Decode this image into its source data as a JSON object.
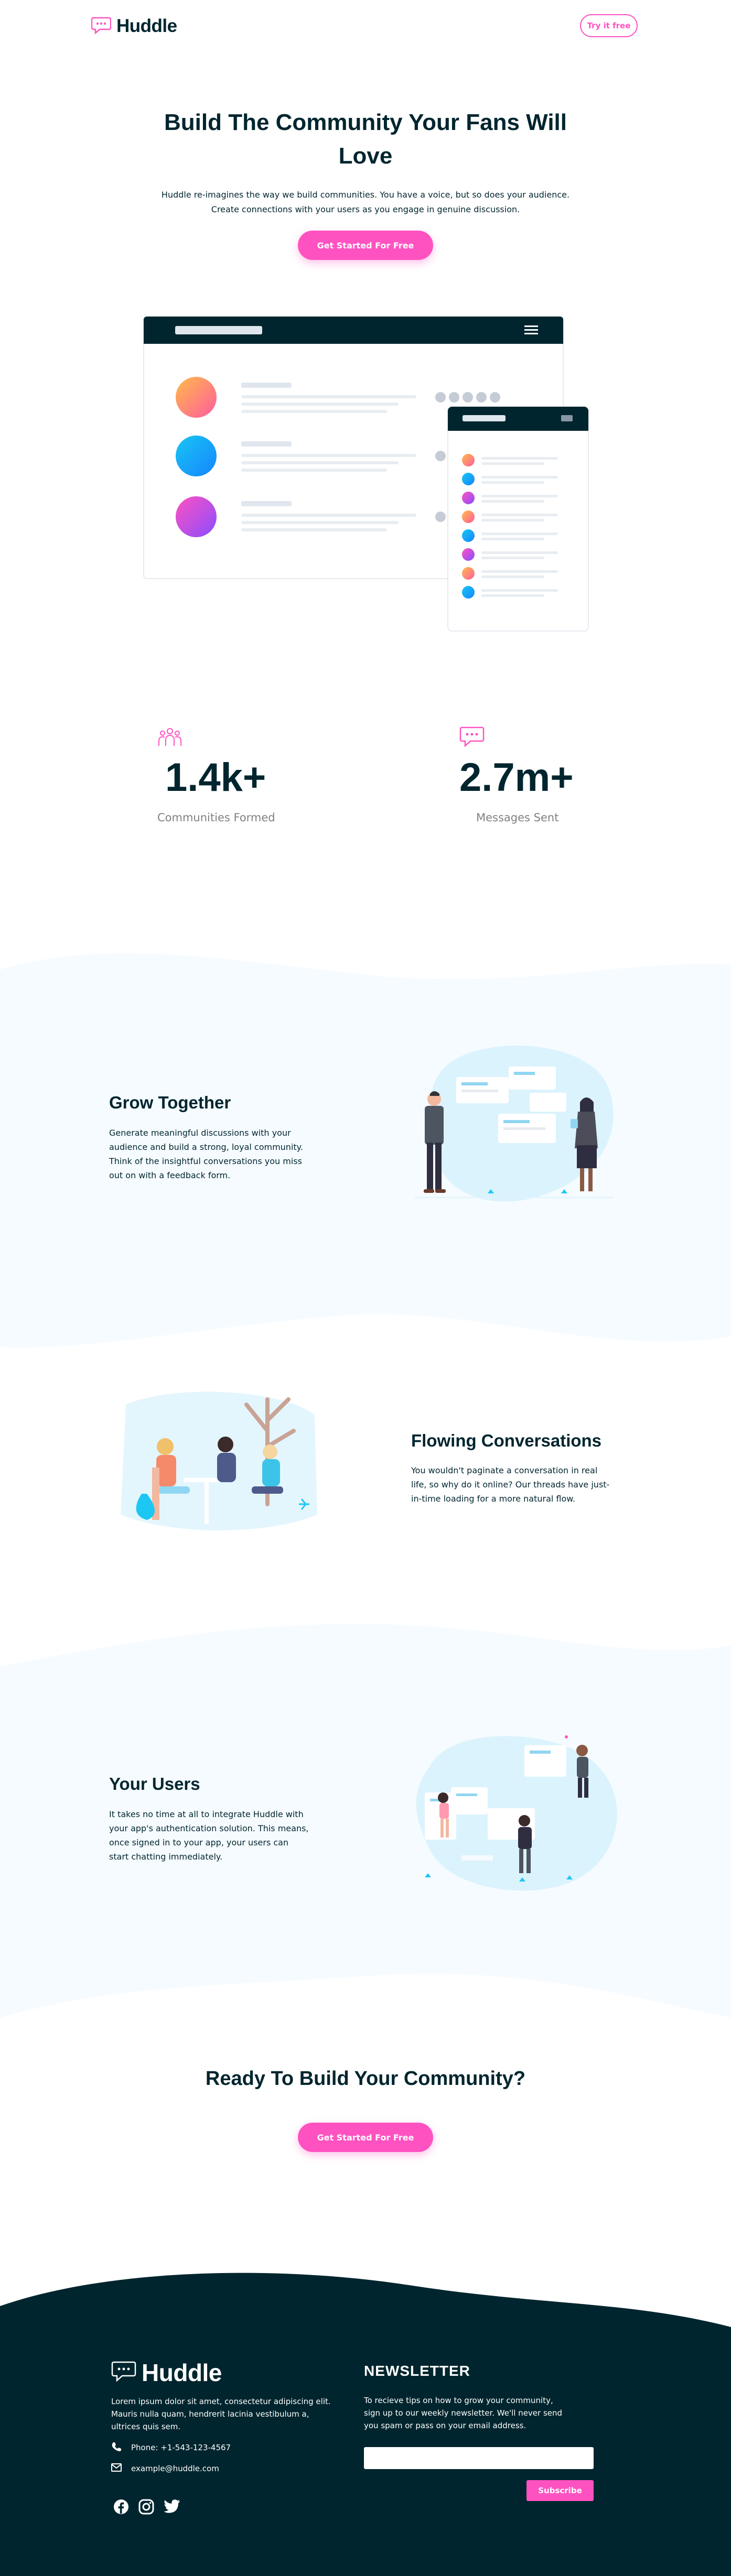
{
  "header": {
    "brand": "Huddle",
    "cta_label": "Try it free"
  },
  "hero": {
    "title_line1": "Build The Community Your Fans Will",
    "title_line2": "Love",
    "subtitle_line1": "Huddle re-imagines the way we build communities. You have a voice, but so does your audience.",
    "subtitle_line2": "Create connections with your users as you engage in genuine discussion.",
    "button_label": "Get Started For Free"
  },
  "stats": [
    {
      "value": "1.4k+",
      "label": "Communities Formed",
      "icon": "communities-icon"
    },
    {
      "value": "2.7m+",
      "label": "Messages Sent",
      "icon": "messages-icon"
    }
  ],
  "features": [
    {
      "title": "Grow Together",
      "lines": [
        "Generate meaningful discussions with your",
        "audience and build a strong, loyal community.",
        "Think of the insightful conversations you miss",
        "out on with a feedback form."
      ]
    },
    {
      "title": "Flowing Conversations",
      "lines": [
        "You wouldn't paginate a conversation in real",
        "life, so why do it online? Our threads have just-",
        "in-time loading for a more natural flow."
      ]
    },
    {
      "title": "Your Users",
      "lines": [
        "It takes no time at all to integrate Huddle with",
        "your app's authentication solution. This means,",
        "once signed in to your app, your users can",
        "start chatting immediately."
      ]
    }
  ],
  "cta": {
    "title": "Ready To Build Your Community?",
    "button_label": "Get Started For Free"
  },
  "footer": {
    "brand": "Huddle",
    "about_lines": [
      "Lorem ipsum dolor sit amet, consectetur adipiscing elit.",
      "Mauris nulla quam, hendrerit lacinia vestibulum a,",
      "ultrices quis sem."
    ],
    "phone": "Phone: +1-543-123-4567",
    "email": "example@huddle.com",
    "newsletter_title": "NEWSLETTER",
    "newsletter_lines": [
      "To recieve tips on how to grow your community,",
      "sign up to our weekly newsletter. We'll never send",
      "you spam or pass on your email address."
    ],
    "subscribe_label": "Subscribe",
    "social": [
      "facebook-icon",
      "instagram-icon",
      "twitter-icon"
    ]
  },
  "colors": {
    "pink": "#ff52c1",
    "dark": "#00252e",
    "light_bg": "#f5fbff",
    "gray": "#808080"
  }
}
